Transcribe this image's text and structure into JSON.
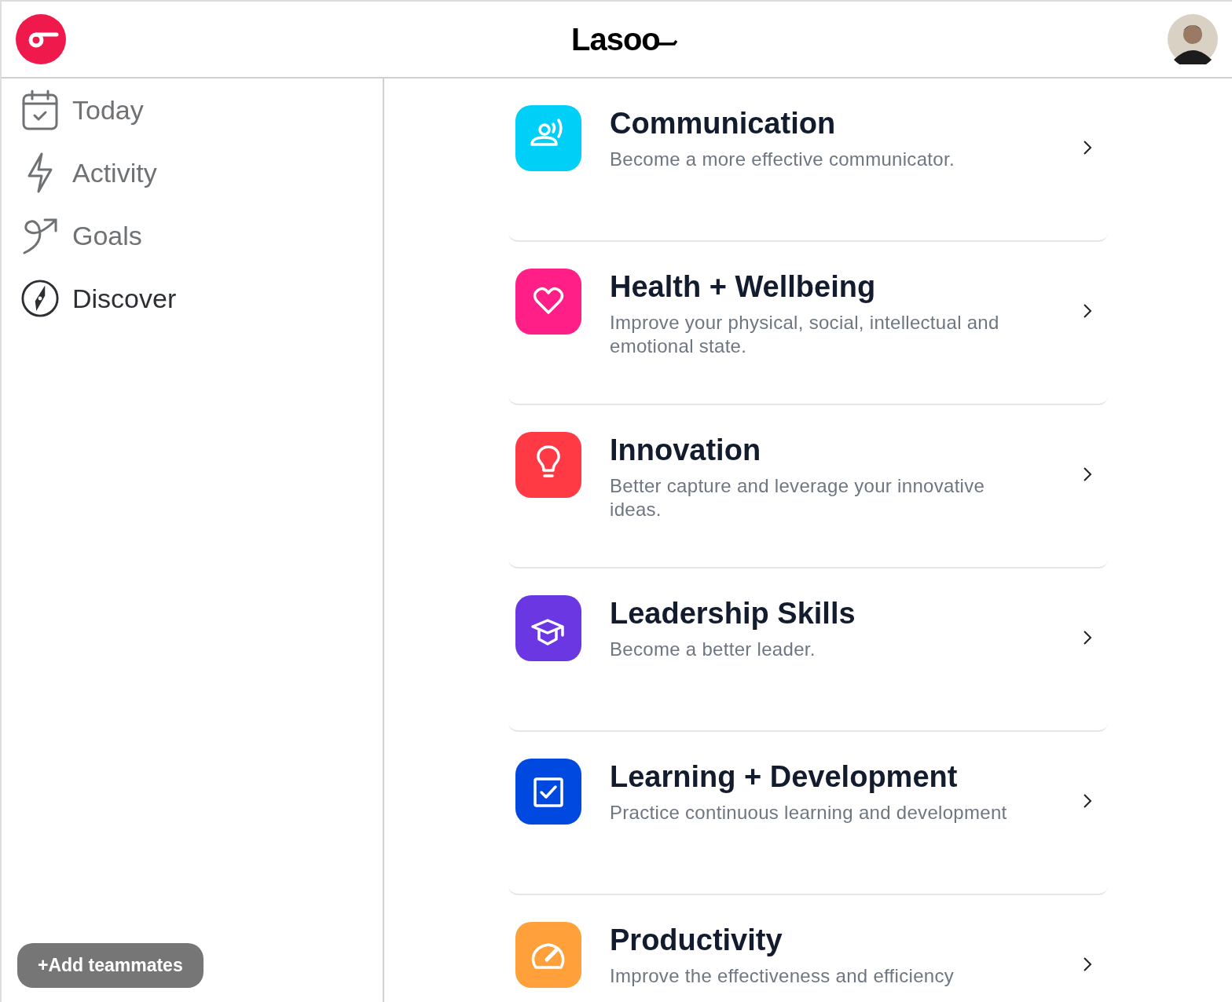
{
  "header": {
    "logo": "Lasoo"
  },
  "sidebar": {
    "items": [
      {
        "label": "Today",
        "kind": "calendar",
        "selected": false
      },
      {
        "label": "Activity",
        "kind": "bolt",
        "selected": false
      },
      {
        "label": "Goals",
        "kind": "goal",
        "selected": false
      },
      {
        "label": "Discover",
        "kind": "compass",
        "selected": true
      }
    ],
    "add_button": "+Add teammates"
  },
  "categories": [
    {
      "title": "Communication",
      "description": "Become a more effective communicator.",
      "kind": "speaker",
      "color": "#00cff7"
    },
    {
      "title": "Health + Wellbeing",
      "description": "Improve your physical, social, intellectual and emotional state.",
      "kind": "heart",
      "color": "#ff1f86"
    },
    {
      "title": "Innovation",
      "description": "Better capture and leverage your innovative ideas.",
      "kind": "bulb",
      "color": "#ff3a44"
    },
    {
      "title": "Leadership Skills",
      "description": "Become a better leader.",
      "kind": "cap",
      "color": "#6a37e3"
    },
    {
      "title": "Learning + Development",
      "description": "Practice continuous learning and development",
      "kind": "checkbox",
      "color": "#0049e0"
    },
    {
      "title": "Productivity",
      "description": "Improve the effectiveness and efficiency",
      "kind": "gauge",
      "color": "#ffa03a"
    }
  ]
}
